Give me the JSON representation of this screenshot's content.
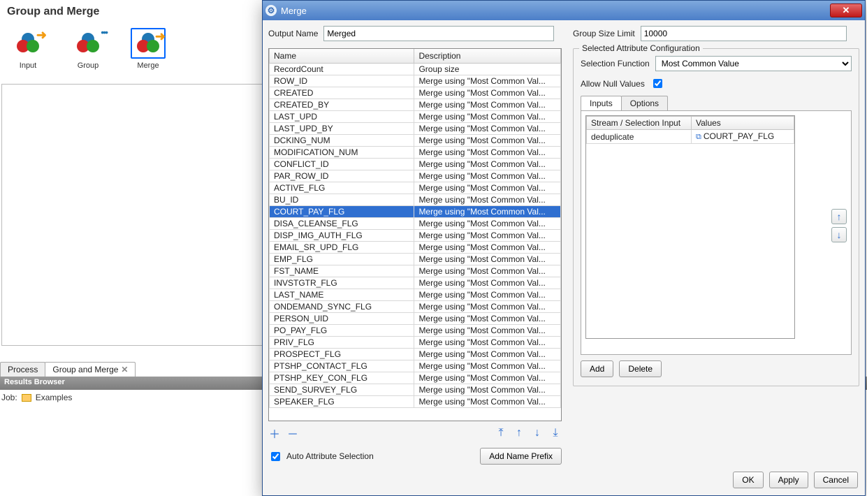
{
  "canvas": {
    "title": "Group and Merge",
    "nodes": [
      {
        "label": "Input",
        "selected": false,
        "overlay": "arrow"
      },
      {
        "label": "Group",
        "selected": false,
        "overlay": "dots"
      },
      {
        "label": "Merge",
        "selected": true,
        "overlay": "arrow"
      }
    ]
  },
  "lower_tabs": [
    {
      "label": "Process",
      "closable": false,
      "active": false
    },
    {
      "label": "Group and Merge",
      "closable": true,
      "active": true
    }
  ],
  "results_bar": "Results Browser",
  "job": {
    "label": "Job:",
    "name": "Examples"
  },
  "dialog": {
    "title": "Merge",
    "output_name_label": "Output Name",
    "output_name_value": "Merged",
    "group_size_label": "Group Size Limit",
    "group_size_value": "10000",
    "grid": {
      "headers": {
        "name": "Name",
        "desc": "Description"
      },
      "selected_index": 11,
      "rows": [
        {
          "name": "RecordCount",
          "desc": "Group size"
        },
        {
          "name": "ROW_ID",
          "desc": "Merge using \"Most Common Val..."
        },
        {
          "name": "CREATED",
          "desc": "Merge using \"Most Common Val..."
        },
        {
          "name": "CREATED_BY",
          "desc": "Merge using \"Most Common Val..."
        },
        {
          "name": "LAST_UPD",
          "desc": "Merge using \"Most Common Val..."
        },
        {
          "name": "LAST_UPD_BY",
          "desc": "Merge using \"Most Common Val..."
        },
        {
          "name": "DCKING_NUM",
          "desc": "Merge using \"Most Common Val..."
        },
        {
          "name": "MODIFICATION_NUM",
          "desc": "Merge using \"Most Common Val..."
        },
        {
          "name": "CONFLICT_ID",
          "desc": "Merge using \"Most Common Val..."
        },
        {
          "name": "PAR_ROW_ID",
          "desc": "Merge using \"Most Common Val..."
        },
        {
          "name": "ACTIVE_FLG",
          "desc": "Merge using \"Most Common Val..."
        },
        {
          "name": "BU_ID",
          "desc": "Merge using \"Most Common Val..."
        },
        {
          "name": "COURT_PAY_FLG",
          "desc": "Merge using \"Most Common Val..."
        },
        {
          "name": "DISA_CLEANSE_FLG",
          "desc": "Merge using \"Most Common Val..."
        },
        {
          "name": "DISP_IMG_AUTH_FLG",
          "desc": "Merge using \"Most Common Val..."
        },
        {
          "name": "EMAIL_SR_UPD_FLG",
          "desc": "Merge using \"Most Common Val..."
        },
        {
          "name": "EMP_FLG",
          "desc": "Merge using \"Most Common Val..."
        },
        {
          "name": "FST_NAME",
          "desc": "Merge using \"Most Common Val..."
        },
        {
          "name": "INVSTGTR_FLG",
          "desc": "Merge using \"Most Common Val..."
        },
        {
          "name": "LAST_NAME",
          "desc": "Merge using \"Most Common Val..."
        },
        {
          "name": "ONDEMAND_SYNC_FLG",
          "desc": "Merge using \"Most Common Val..."
        },
        {
          "name": "PERSON_UID",
          "desc": "Merge using \"Most Common Val..."
        },
        {
          "name": "PO_PAY_FLG",
          "desc": "Merge using \"Most Common Val..."
        },
        {
          "name": "PRIV_FLG",
          "desc": "Merge using \"Most Common Val..."
        },
        {
          "name": "PROSPECT_FLG",
          "desc": "Merge using \"Most Common Val..."
        },
        {
          "name": "PTSHP_CONTACT_FLG",
          "desc": "Merge using \"Most Common Val..."
        },
        {
          "name": "PTSHP_KEY_CON_FLG",
          "desc": "Merge using \"Most Common Val..."
        },
        {
          "name": "SEND_SURVEY_FLG",
          "desc": "Merge using \"Most Common Val..."
        },
        {
          "name": "SPEAKER_FLG",
          "desc": "Merge using \"Most Common Val..."
        }
      ]
    },
    "auto_attr_label": "Auto Attribute Selection",
    "auto_attr_checked": true,
    "add_prefix_label": "Add Name Prefix",
    "config": {
      "legend": "Selected Attribute Configuration",
      "sel_fn_label": "Selection Function",
      "sel_fn_value": "Most Common Value",
      "allow_null_label": "Allow Null Values",
      "allow_null_checked": true,
      "tabs": [
        {
          "label": "Inputs",
          "active": true
        },
        {
          "label": "Options",
          "active": false
        }
      ],
      "inputs_grid": {
        "headers": {
          "stream": "Stream / Selection Input",
          "values": "Values"
        },
        "rows": [
          {
            "stream": "deduplicate",
            "values": "COURT_PAY_FLG"
          }
        ]
      },
      "add_label": "Add",
      "delete_label": "Delete"
    },
    "footer": {
      "ok": "OK",
      "apply": "Apply",
      "cancel": "Cancel"
    }
  }
}
